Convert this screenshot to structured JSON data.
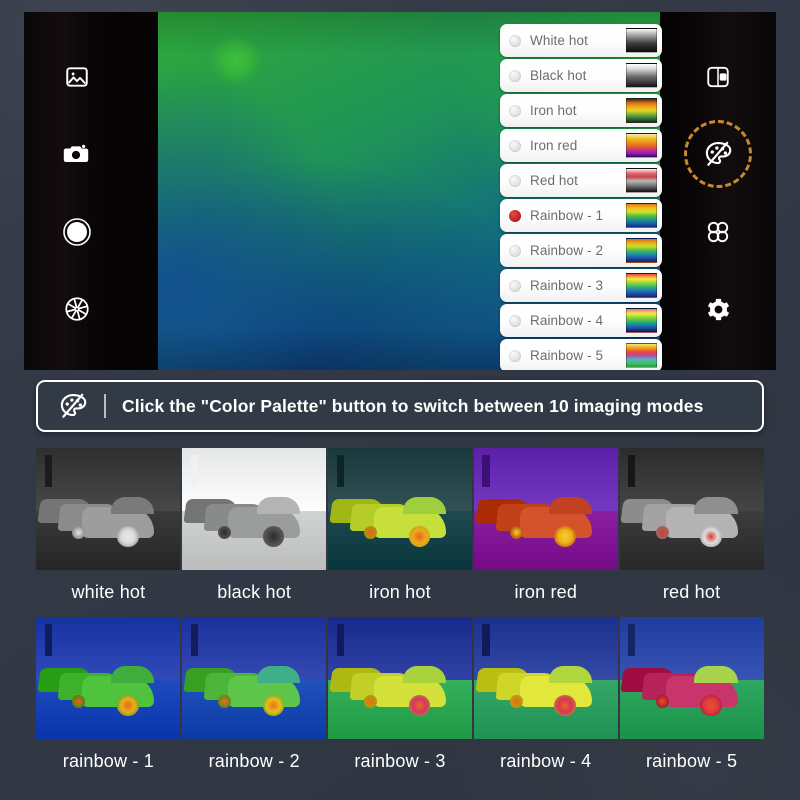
{
  "device": {
    "left_toolbar": [
      {
        "name": "gallery-icon",
        "label": "Gallery"
      },
      {
        "name": "camera-icon",
        "label": "Photo"
      },
      {
        "name": "shutter-icon",
        "label": "Shutter"
      },
      {
        "name": "aperture-icon",
        "label": "Aperture"
      }
    ],
    "right_toolbar": [
      {
        "name": "picture-in-picture-icon",
        "label": "Picture in picture"
      },
      {
        "name": "color-palette-icon",
        "label": "Color Palette",
        "highlighted": true
      },
      {
        "name": "grid-modes-icon",
        "label": "Modes"
      },
      {
        "name": "gear-icon",
        "label": "Settings"
      }
    ]
  },
  "palette_list": {
    "selected": "Rainbow - 1",
    "items": [
      {
        "label": "White hot",
        "swatch": "sw-white-hot",
        "selected": false
      },
      {
        "label": "Black hot",
        "swatch": "sw-black-hot",
        "selected": false
      },
      {
        "label": "Iron hot",
        "swatch": "sw-iron-hot",
        "selected": false
      },
      {
        "label": "Iron red",
        "swatch": "sw-iron-red",
        "selected": false
      },
      {
        "label": "Red hot",
        "swatch": "sw-red-hot",
        "selected": false
      },
      {
        "label": "Rainbow - 1",
        "swatch": "sw-rainbow-1",
        "selected": true
      },
      {
        "label": "Rainbow - 2",
        "swatch": "sw-rainbow-2",
        "selected": false
      },
      {
        "label": "Rainbow - 3",
        "swatch": "sw-rainbow-3",
        "selected": false
      },
      {
        "label": "Rainbow - 4",
        "swatch": "sw-rainbow-4",
        "selected": false
      },
      {
        "label": "Rainbow - 5",
        "swatch": "sw-rainbow-5",
        "selected": false
      }
    ]
  },
  "banner": {
    "icon": "color-palette-icon",
    "text": "Click the \"Color Palette\" button to switch between 10 imaging modes"
  },
  "samples": [
    {
      "caption": "white hot",
      "colors": {
        "sky": "#2e2e2e",
        "ground": "#3a3a3a",
        "car": "#9d9d9d",
        "roof": "#7a7a7a",
        "hot": "#dcdcdc",
        "wheel": "#e8e8e8",
        "pole": "#1a1a1a"
      }
    },
    {
      "caption": "black hot",
      "colors": {
        "sky": "#e6e8e8",
        "ground": "#d2d4d4",
        "car": "#9b9d9d",
        "roof": "#b4b6b6",
        "hot": "#4a4a4a",
        "wheel": "#2a2a2a",
        "pole": "#f2f2f2"
      }
    },
    {
      "caption": "iron hot",
      "colors": {
        "sky": "#17383c",
        "ground": "#1d4a50",
        "car": "#c8e03a",
        "roof": "#9fd03a",
        "hot": "#f0a81c",
        "wheel": "#e8641a",
        "pole": "#0d2326"
      }
    },
    {
      "caption": "iron red",
      "colors": {
        "sky": "#5b1fa8",
        "ground": "#8a1f9e",
        "car": "#d4522a",
        "roof": "#c2401f",
        "hot": "#f0b01c",
        "wheel": "#f5d02a",
        "pole": "#3c0f78"
      }
    },
    {
      "caption": "red hot",
      "colors": {
        "sky": "#2b2b2b",
        "ground": "#3c3c3c",
        "car": "#b4b4b4",
        "roof": "#8f8f8f",
        "hot": "#e0e0e0",
        "wheel": "#d9392f",
        "pole": "#151515"
      }
    },
    {
      "caption": "rainbow - 1",
      "colors": {
        "sky": "#1530a0",
        "ground": "#1f4ac0",
        "car": "#4fc43c",
        "roof": "#3fae3c",
        "hot": "#e8b01c",
        "wheel": "#e8641a",
        "pole": "#0c1c60"
      }
    },
    {
      "caption": "rainbow - 2",
      "colors": {
        "sky": "#1a2f9a",
        "ground": "#2050bb",
        "car": "#5ec84a",
        "roof": "#3fb08a",
        "hot": "#e8c01c",
        "wheel": "#e8701a",
        "pole": "#101c5c"
      }
    },
    {
      "caption": "rainbow - 3",
      "colors": {
        "sky": "#16288c",
        "ground": "#34b05a",
        "car": "#d6e23a",
        "roof": "#a8d43c",
        "hot": "#d6346a",
        "wheel": "#e8701a",
        "pole": "#0e1a5c"
      }
    },
    {
      "caption": "rainbow - 4",
      "colors": {
        "sky": "#1a2f8c",
        "ground": "#34a868",
        "car": "#e2e83a",
        "roof": "#b0d83c",
        "hot": "#d6345a",
        "wheel": "#e86a1a",
        "pole": "#0e1a5c"
      }
    },
    {
      "caption": "rainbow - 5",
      "colors": {
        "sky": "#1e3a9c",
        "ground": "#2fa85e",
        "car": "#c8346a",
        "roof": "#a8d44c",
        "hot": "#e03a3a",
        "wheel": "#e8502a",
        "pole": "#122464"
      }
    }
  ],
  "colors": {
    "page_background": "#333a45",
    "banner_background": "#323a46",
    "banner_border": "#ffffff",
    "highlight_ring": "#c88b2b",
    "selected_radio": "#c21f1f",
    "label_text": "#6d6d6d"
  }
}
